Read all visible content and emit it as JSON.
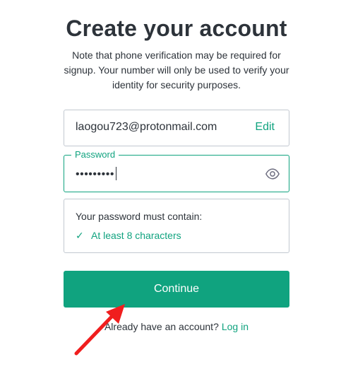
{
  "page": {
    "title": "Create your account",
    "subtitle": "Note that phone verification may be required for signup. Your number will only be used to verify your identity for security purposes."
  },
  "email": {
    "value": "laogou723@protonmail.com",
    "edit_label": "Edit"
  },
  "password": {
    "label": "Password",
    "value_masked": "•••••••••",
    "visibility_icon": "eye-icon"
  },
  "requirements": {
    "title": "Your password must contain:",
    "items": [
      {
        "icon": "check-icon",
        "glyph": "✓",
        "label": "At least 8 characters",
        "met": true
      }
    ]
  },
  "actions": {
    "continue_label": "Continue",
    "login_prompt": "Already have an account?",
    "login_label": "Log in"
  },
  "annotation": {
    "type": "red-arrow",
    "color": "#f01e1e",
    "target": "continue-button"
  },
  "colors": {
    "accent": "#10a37f",
    "text": "#2d333a",
    "border": "#c2c8d0",
    "background": "#ffffff"
  }
}
